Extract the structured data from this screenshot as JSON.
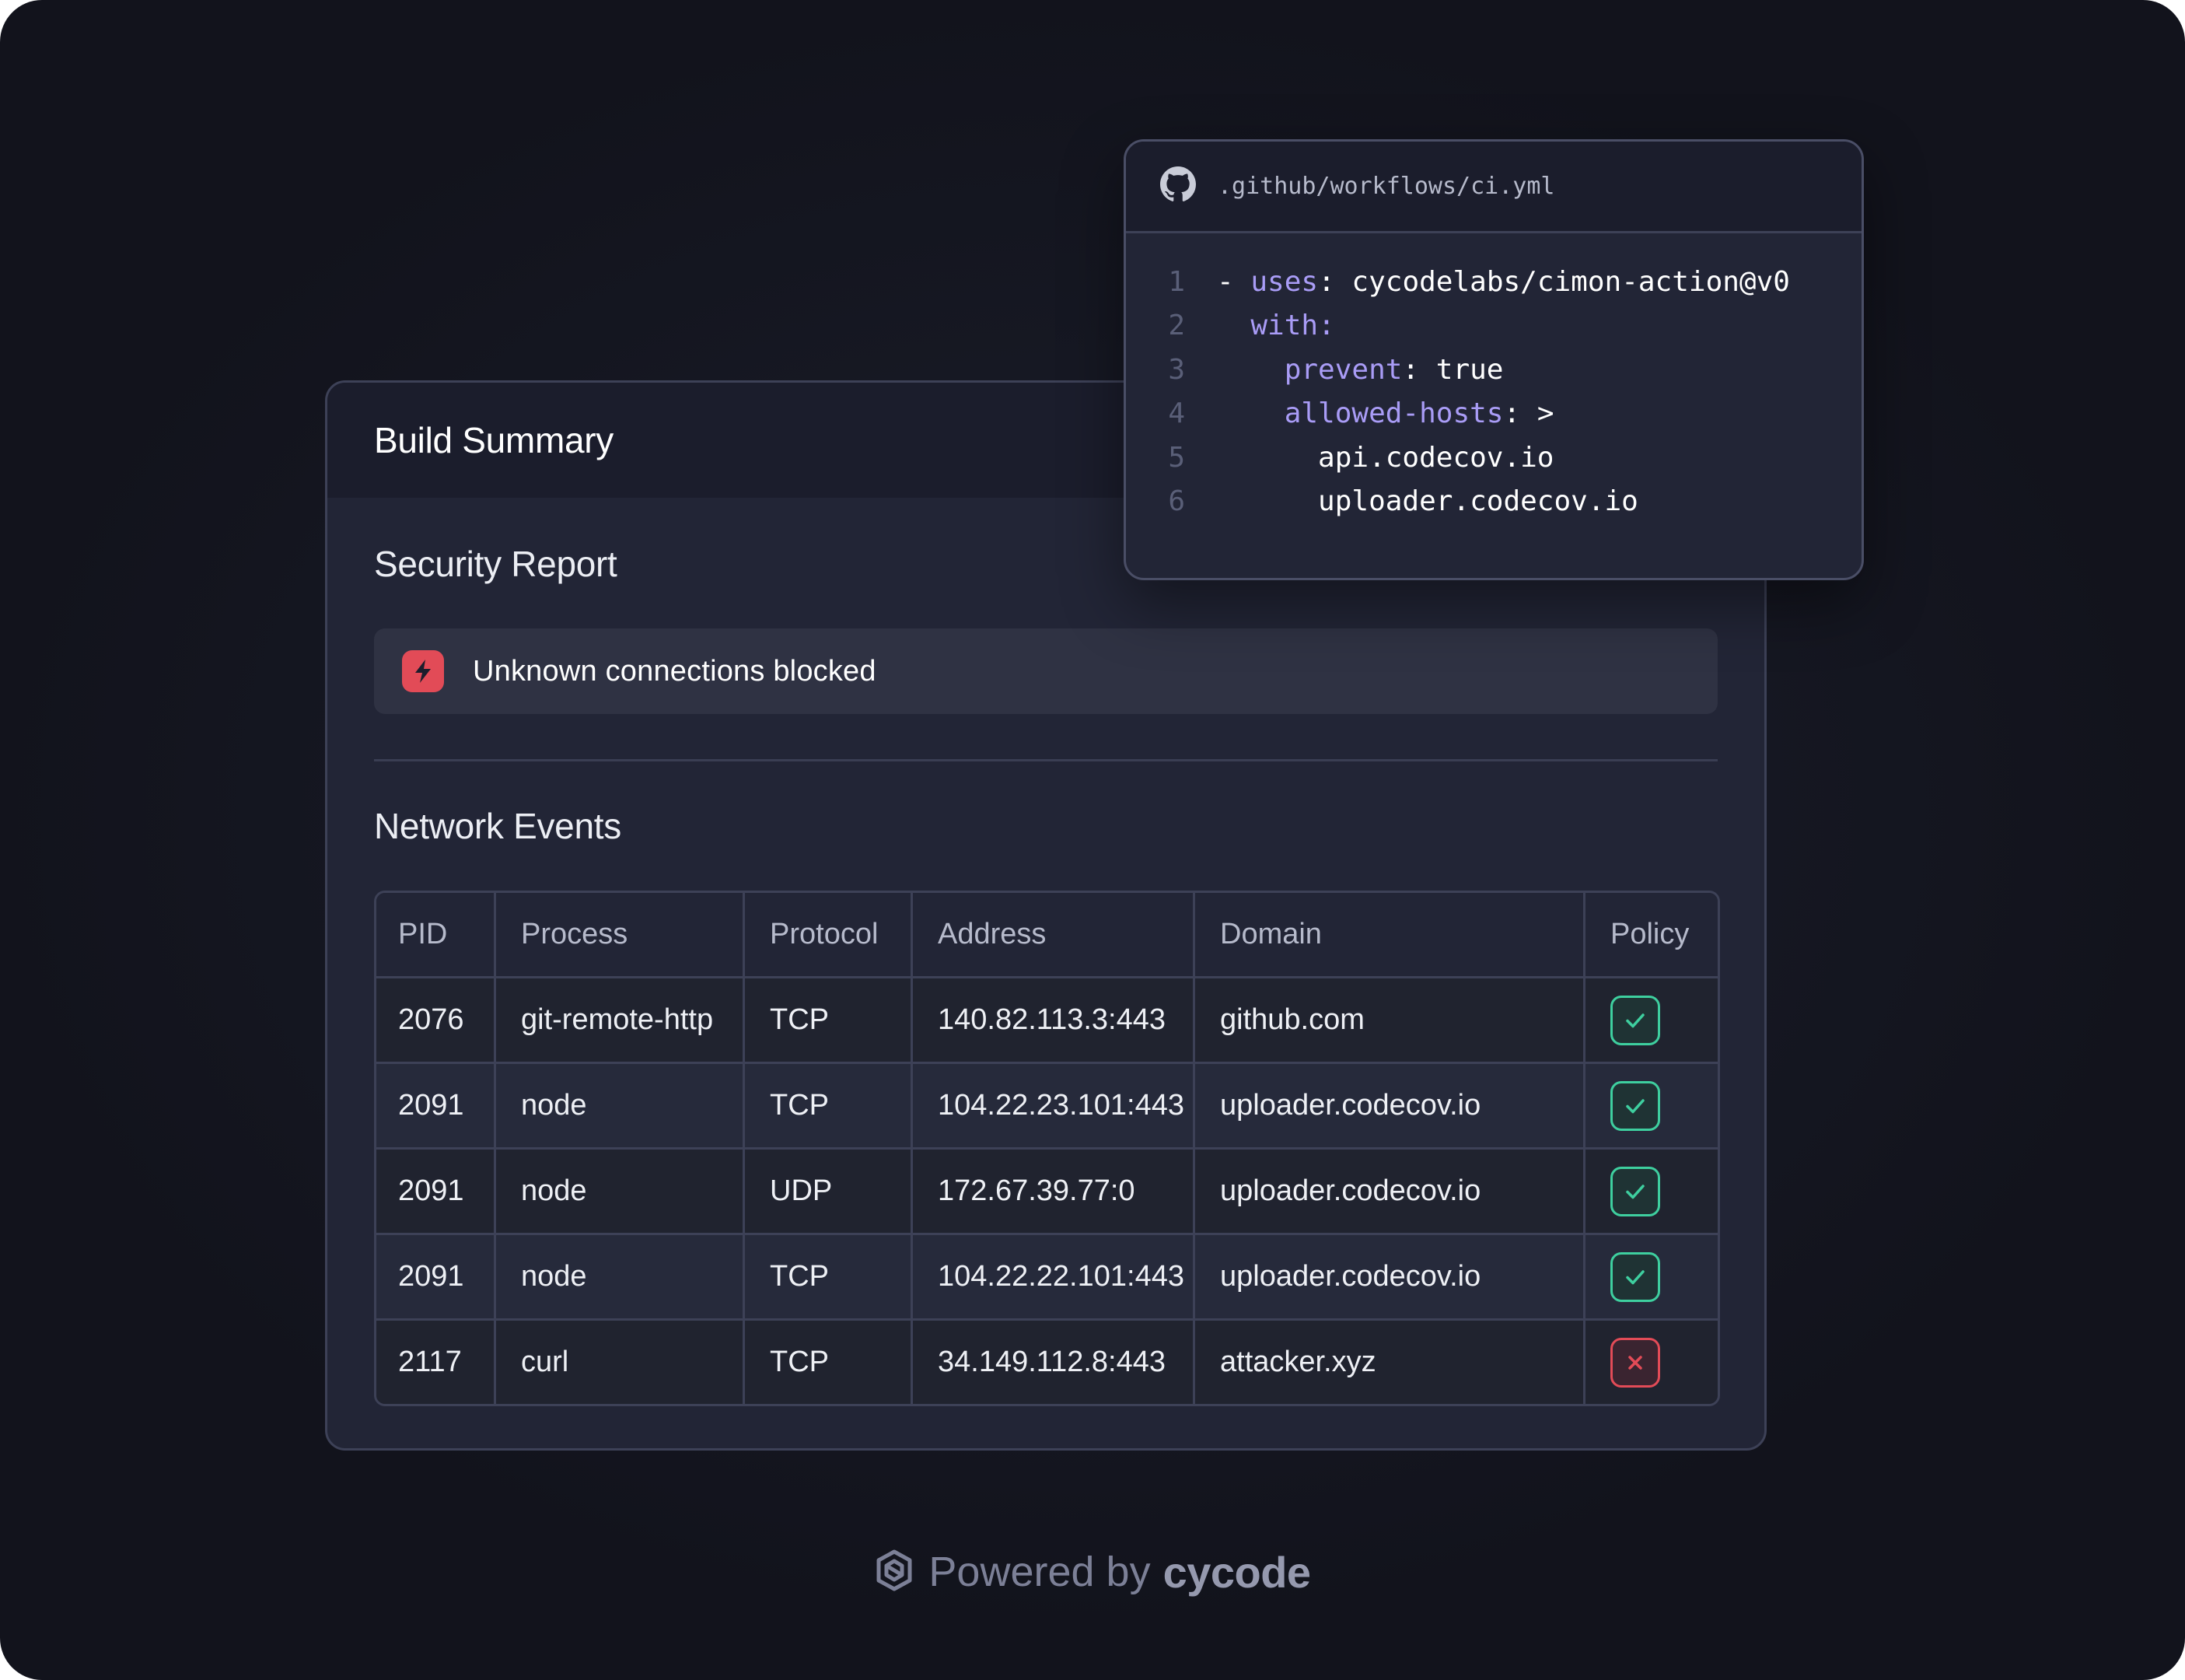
{
  "build_summary": {
    "title": "Build Summary",
    "security_title": "Security Report",
    "alert_text": "Unknown connections blocked",
    "alert_icon": "bolt-icon",
    "network_title": "Network Events"
  },
  "table": {
    "headers": [
      "PID",
      "Process",
      "Protocol",
      "Address",
      "Domain",
      "Policy"
    ],
    "rows": [
      {
        "pid": "2076",
        "process": "git-remote-http",
        "protocol": "TCP",
        "address": "140.82.113.3:443",
        "domain": "github.com",
        "policy": "allowed"
      },
      {
        "pid": "2091",
        "process": "node",
        "protocol": "TCP",
        "address": "104.22.23.101:443",
        "domain": "uploader.codecov.io",
        "policy": "allowed"
      },
      {
        "pid": "2091",
        "process": "node",
        "protocol": "UDP",
        "address": "172.67.39.77:0",
        "domain": "uploader.codecov.io",
        "policy": "allowed"
      },
      {
        "pid": "2091",
        "process": "node",
        "protocol": "TCP",
        "address": "104.22.22.101:443",
        "domain": "uploader.codecov.io",
        "policy": "allowed"
      },
      {
        "pid": "2117",
        "process": "curl",
        "protocol": "TCP",
        "address": "34.149.112.8:443",
        "domain": "attacker.xyz",
        "policy": "blocked"
      }
    ]
  },
  "code_window": {
    "icon": "github-icon",
    "path": ".github/workflows/ci.yml",
    "lines": [
      {
        "n": "1",
        "dash": "- ",
        "key": "uses",
        "sep": ": ",
        "value": "cycodelabs/cimon-action@v0",
        "indent": ""
      },
      {
        "n": "2",
        "dash": "",
        "key": "with",
        "sep": ":",
        "value": "",
        "indent": "  "
      },
      {
        "n": "3",
        "dash": "",
        "key": "prevent",
        "sep": ": ",
        "value": "true",
        "indent": "    "
      },
      {
        "n": "4",
        "dash": "",
        "key": "allowed-hosts",
        "sep": ": ",
        "value": ">",
        "indent": "    "
      },
      {
        "n": "5",
        "dash": "",
        "key": "",
        "sep": "",
        "value": "api.codecov.io",
        "indent": "      "
      },
      {
        "n": "6",
        "dash": "",
        "key": "",
        "sep": "",
        "value": "uploader.codecov.io",
        "indent": "      "
      }
    ]
  },
  "colors": {
    "background": "#161823",
    "card": "#222536",
    "alert_red": "#e24b57",
    "allow_green": "#3ecf9f",
    "yaml_key": "#a99cf6"
  },
  "footer": {
    "icon": "cycode-logo-icon",
    "prefix": "Powered by",
    "brand": "cycode"
  }
}
